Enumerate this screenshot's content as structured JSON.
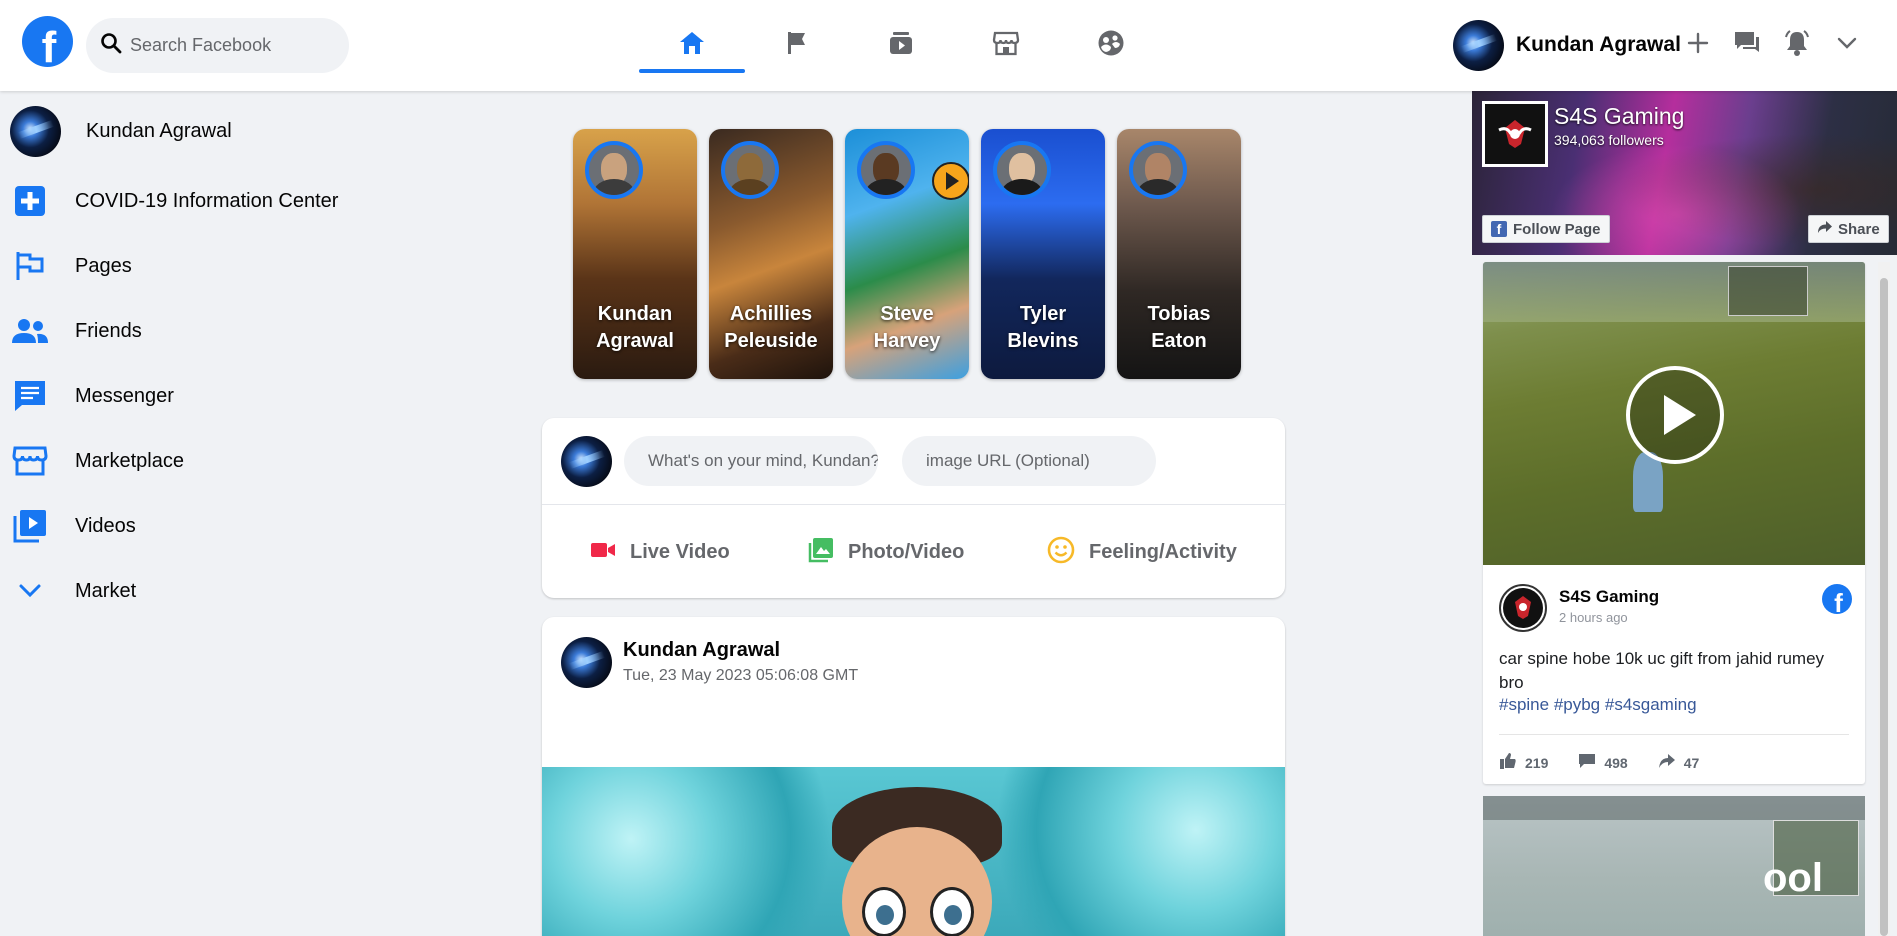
{
  "header": {
    "search_placeholder": "Search Facebook",
    "user_name": "Kundan Agrawal",
    "tabs": [
      "home",
      "pages",
      "watch",
      "marketplace",
      "groups"
    ],
    "active_tab": "home"
  },
  "sidebar": {
    "profile_name": "Kundan Agrawal",
    "items": [
      {
        "label": "COVID-19 Information Center",
        "icon": "covid-plus-icon"
      },
      {
        "label": "Pages",
        "icon": "flag-icon"
      },
      {
        "label": "Friends",
        "icon": "friends-icon"
      },
      {
        "label": "Messenger",
        "icon": "messenger-icon"
      },
      {
        "label": "Marketplace",
        "icon": "marketplace-icon"
      },
      {
        "label": "Videos",
        "icon": "video-icon"
      },
      {
        "label": "Market",
        "icon": "chevron-down-icon"
      }
    ]
  },
  "stories": [
    {
      "line1": "Kundan",
      "line2": "Agrawal"
    },
    {
      "line1": "Achillies",
      "line2": "Peleuside"
    },
    {
      "line1": "Steve",
      "line2": "Harvey"
    },
    {
      "line1": "Tyler",
      "line2": "Blevins"
    },
    {
      "line1": "Tobias",
      "line2": "Eaton"
    }
  ],
  "composer": {
    "status_placeholder": "What's on your mind, Kundan?",
    "image_placeholder": "image URL (Optional)",
    "actions": [
      {
        "label": "Live Video",
        "color": "#f02849"
      },
      {
        "label": "Photo/Video",
        "color": "#45bd62"
      },
      {
        "label": "Feeling/Activity",
        "color": "#f7b928"
      }
    ]
  },
  "post": {
    "author": "Kundan Agrawal",
    "timestamp": "Tue, 23 May 2023 05:06:08 GMT"
  },
  "page_plugin": {
    "name": "S4S Gaming",
    "followers": "394,063 followers",
    "follow_label": "Follow Page",
    "share_label": "Share"
  },
  "plugin_post": {
    "page_name": "S4S Gaming",
    "time": "2 hours ago",
    "text": "car spine hobe 10k uc gift from jahid rumey bro",
    "hashtags": "#spine #pybg #s4sgaming",
    "likes": "219",
    "comments": "498",
    "shares": "47"
  },
  "colors": {
    "brand": "#1877f2",
    "background": "#f0f2f5"
  }
}
